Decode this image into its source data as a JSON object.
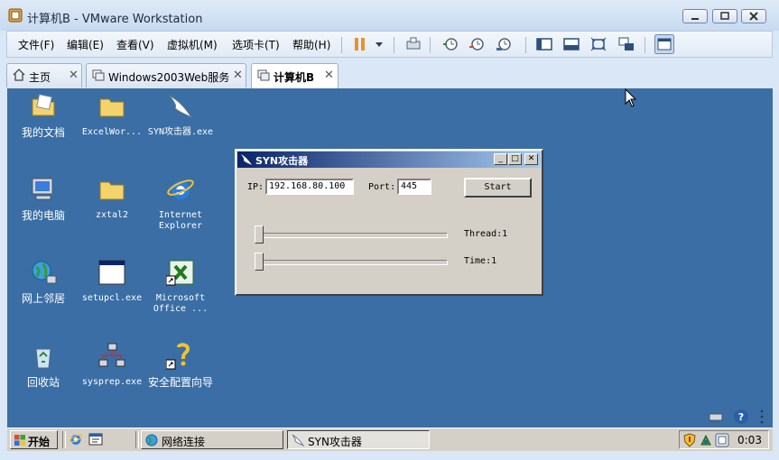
{
  "window": {
    "title": "计算机B - VMware Workstation"
  },
  "menu": {
    "items": [
      "文件(F)",
      "编辑(E)",
      "查看(V)",
      "虚拟机(M)",
      "选项卡(T)",
      "帮助(H)"
    ]
  },
  "tabs": [
    {
      "label": "主页",
      "icon": "home-icon",
      "active": false
    },
    {
      "label": "Windows2003Web服务",
      "icon": "vm-icon",
      "active": false
    },
    {
      "label": "计算机B",
      "icon": "vm-icon",
      "active": true
    }
  ],
  "desktop": {
    "icons": [
      {
        "caption": "我的文档",
        "icon": "my-documents-icon"
      },
      {
        "caption": "ExcelWor...",
        "icon": "folder-icon"
      },
      {
        "caption": "SYN攻击器.exe",
        "icon": "syn-attacker-icon"
      },
      {
        "caption": "我的电脑",
        "icon": "my-computer-icon"
      },
      {
        "caption": "zxtal2",
        "icon": "folder-icon"
      },
      {
        "caption": "Internet Explorer",
        "icon": "ie-icon"
      },
      {
        "caption": "网上邻居",
        "icon": "network-places-icon"
      },
      {
        "caption": "setupcl.exe",
        "icon": "window-app-icon"
      },
      {
        "caption": "Microsoft Office ...",
        "icon": "excel-shortcut-icon"
      },
      {
        "caption": "回收站",
        "icon": "recycle-bin-icon"
      },
      {
        "caption": "sysprep.exe",
        "icon": "network-tool-icon"
      },
      {
        "caption": "安全配置向导",
        "icon": "security-wizard-icon"
      }
    ]
  },
  "syn_dialog": {
    "title": "SYN攻击器",
    "ip_label": "IP:",
    "ip_value": "192.168.80.100",
    "port_label": "Port:",
    "port_value": "445",
    "start_label": "Start",
    "thread_label": "Thread:1",
    "time_label": "Time:1",
    "thread_slider_value": 1,
    "time_slider_value": 1
  },
  "taskbar": {
    "start_label": "开始",
    "tasks": [
      {
        "label": "网络连接",
        "active": false
      },
      {
        "label": "SYN攻击器",
        "active": true
      }
    ],
    "clock": "0:03"
  },
  "colors": {
    "desktop": "#3a6ea5",
    "dialog_title_start": "#0a246a",
    "dialog_title_end": "#a6caf0"
  }
}
